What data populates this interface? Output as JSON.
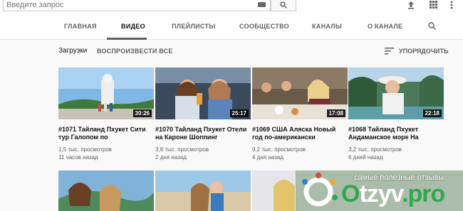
{
  "search": {
    "placeholder": "Введите запрос"
  },
  "tabs": [
    {
      "label": "ГЛАВНАЯ"
    },
    {
      "label": "ВИДЕО"
    },
    {
      "label": "ПЛЕЙЛИСТЫ"
    },
    {
      "label": "СООБЩЕСТВО"
    },
    {
      "label": "КАНАЛЫ"
    },
    {
      "label": "О КАНАЛЕ"
    }
  ],
  "active_tab": "ВИДЕО",
  "section": {
    "title": "Загрузки",
    "play_all": "ВОСПРОИЗВЕСТИ ВСЕ",
    "sort": "УПОРЯДОЧИТЬ"
  },
  "videos": [
    {
      "duration": "30:26",
      "title": "#1071 Тайланд Пхукет Сити тур Галопом по",
      "views": "1,5 тыс. просмотров",
      "age": "11 часов назад"
    },
    {
      "duration": "25:17",
      "title": "#1070 Тайланд Пхукет Отели на Кароне Шоппинг",
      "views": "3,8 тыс. просмотров",
      "age": "2 дня назад"
    },
    {
      "duration": "17:08",
      "title": "#1069 США Аляска Новый год по-американски",
      "views": "9,2 тыс. просмотров",
      "age": "4 дня назад"
    },
    {
      "duration": "22:18",
      "title": "#1068 Тайланд Пхукет Андаманское море На",
      "views": "3,2 тыс. просмотров",
      "age": "6 дней назад"
    }
  ],
  "watermark": {
    "tagline": "самые полезные отзывы",
    "brand_main": "tzyv",
    "brand_o": "O",
    "brand_tld": ".pro"
  },
  "colors": {
    "accent": "#606060",
    "watermark_green": "#2eaa4d"
  }
}
